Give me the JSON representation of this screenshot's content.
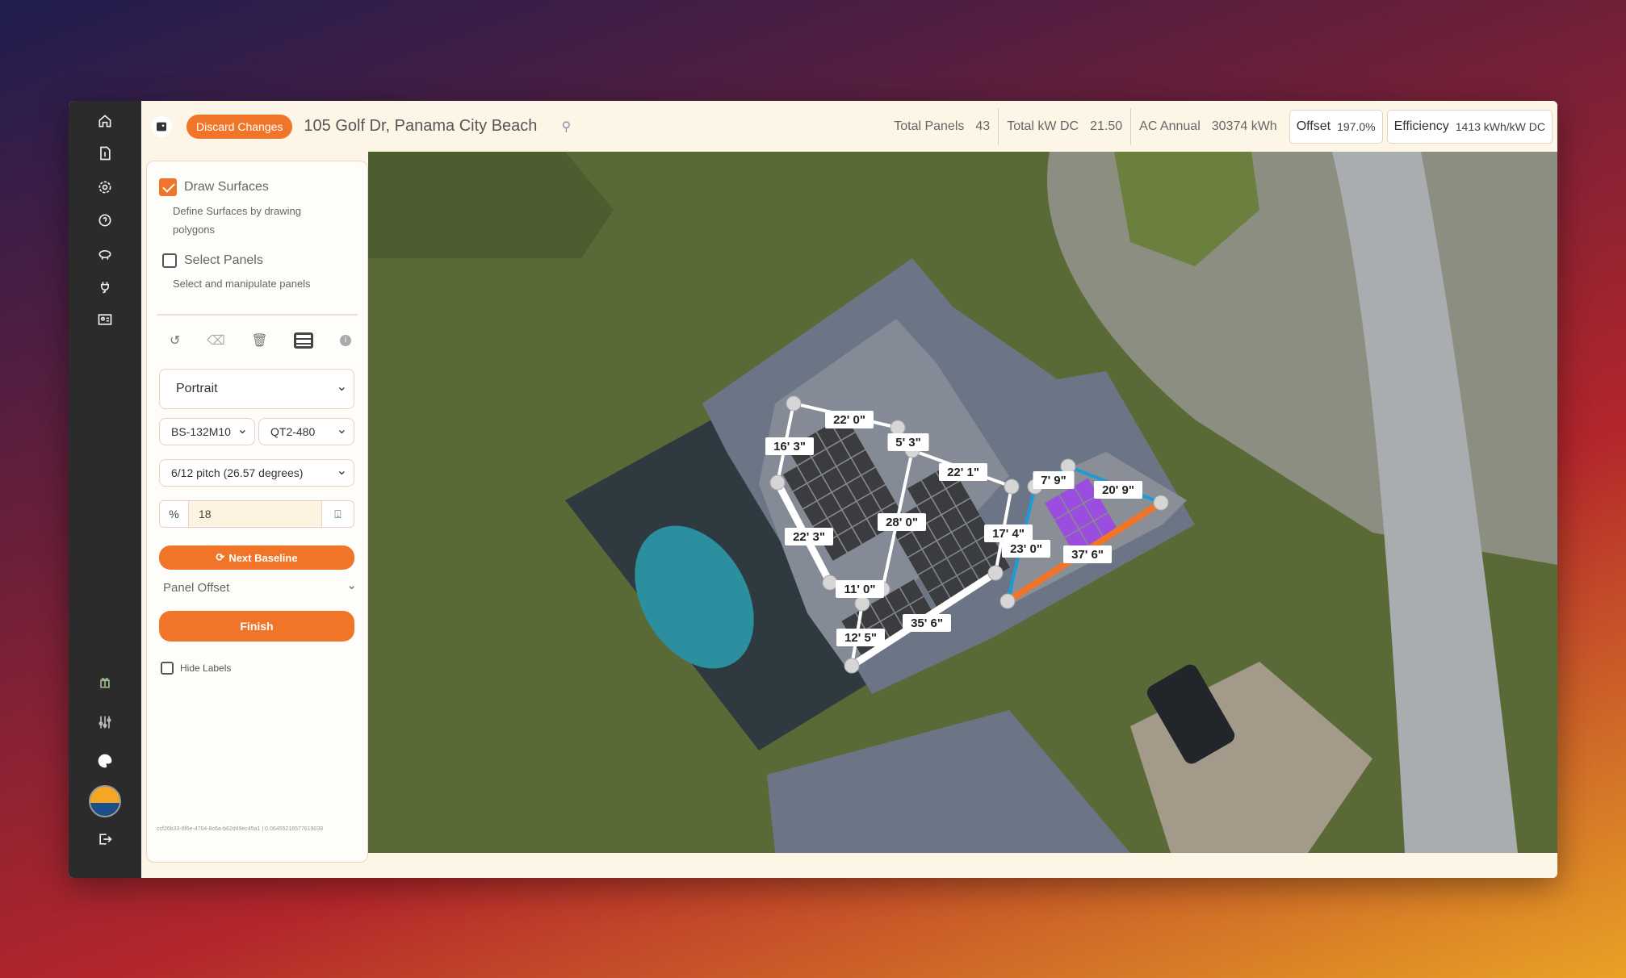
{
  "sidebar": {
    "items": [
      "home-icon",
      "invoice-icon",
      "settings-icon",
      "help-icon",
      "savings-icon",
      "plug-icon",
      "contact-card-icon",
      "gift-icon",
      "sliders-icon",
      "palette-icon",
      "company-logo",
      "logout-icon"
    ]
  },
  "header": {
    "discard_label": "Discard Changes",
    "address": "105 Golf Dr, Panama City Beach",
    "stats": [
      {
        "label": "Total Panels",
        "value": "43"
      },
      {
        "label": "Total kW DC",
        "value": "21.50"
      },
      {
        "label": "AC Annual",
        "value": "30374 kWh"
      }
    ],
    "offset": {
      "label": "Offset",
      "value": "197.0%"
    },
    "efficiency": {
      "label": "Efficiency",
      "value": "1413 kWh/kW DC"
    }
  },
  "panel": {
    "draw_surfaces": {
      "label": "Draw Surfaces",
      "desc": "Define Surfaces by drawing polygons",
      "checked": true
    },
    "select_panels": {
      "label": "Select Panels",
      "desc": "Select and manipulate panels",
      "checked": false
    },
    "orientation": "Portrait",
    "module": "BS-132M10",
    "inverter": "QT2-480",
    "pitch": "6/12 pitch (26.57 degrees)",
    "percent_symbol": "%",
    "percent_value": "18",
    "next_baseline": "Next Baseline",
    "panel_offset": "Panel Offset",
    "finish": "Finish",
    "hide_labels": "Hide Labels",
    "footer_id": "ccf26b33-8f6e-4704-8c6a-b62d49ec45a1 | 0.06455216577619038"
  },
  "map": {
    "labels": [
      "22' 0\"",
      "16' 3\"",
      "5' 3\"",
      "22' 1\"",
      "28' 0\"",
      "22' 3\"",
      "11' 0\"",
      "35' 6\"",
      "12' 5\"",
      "17' 4\"",
      "23' 0\"",
      "7' 9\"",
      "20' 9\"",
      "37' 6\""
    ],
    "colors": {
      "accent": "#f07528",
      "selected_edge": "#1e9bd7",
      "selected_panels": "#9b4de0",
      "edge": "#ffffff"
    }
  }
}
